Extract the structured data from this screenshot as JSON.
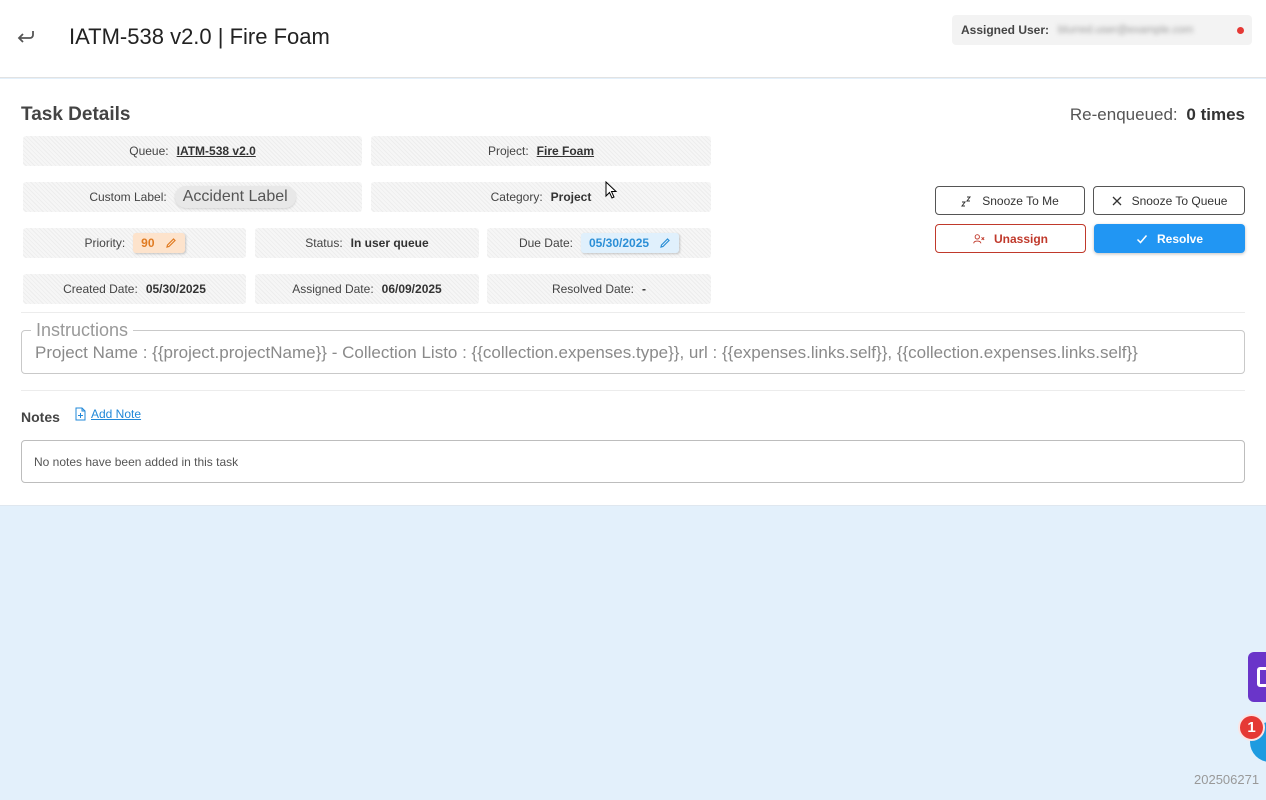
{
  "header": {
    "title": "IATM-538 v2.0 | Fire Foam",
    "assigned_user_label": "Assigned User:",
    "assigned_user_value": "blurred.user@example.com"
  },
  "task": {
    "section_title": "Task Details",
    "reenqueued_label": "Re-enqueued:",
    "reenqueued_value": "0 times",
    "queue_label": "Queue:",
    "queue_value": "IATM-538 v2.0",
    "project_label": "Project:",
    "project_value": "Fire Foam",
    "custom_label_label": "Custom Label:",
    "custom_label_value": "Accident Label",
    "category_label": "Category:",
    "category_value": "Project",
    "priority_label": "Priority:",
    "priority_value": "90",
    "status_label": "Status:",
    "status_value": "In user queue",
    "due_date_label": "Due Date:",
    "due_date_value": "05/30/2025",
    "created_date_label": "Created Date:",
    "created_date_value": "05/30/2025",
    "assigned_date_label": "Assigned Date:",
    "assigned_date_value": "06/09/2025",
    "resolved_date_label": "Resolved Date:",
    "resolved_date_value": "-"
  },
  "actions": {
    "snooze_me": "Snooze To Me",
    "snooze_queue": "Snooze To Queue",
    "unassign": "Unassign",
    "resolve": "Resolve"
  },
  "instructions": {
    "legend": "Instructions",
    "text": "Project Name : {{project.projectName}}  - Collection Listo : {{collection.expenses.type}}, url :  {{expenses.links.self}}, {{collection.expenses.links.self}}"
  },
  "notes": {
    "title": "Notes",
    "add_label": "Add Note",
    "empty_text": "No notes have been added in this task"
  },
  "widgets": {
    "badge_count": "1",
    "version": "202506271"
  },
  "colors": {
    "primary": "#2196f3",
    "danger": "#c0392b",
    "priority": "#e07b22",
    "due": "#2c8fd6",
    "background": "#e3f0fb"
  }
}
